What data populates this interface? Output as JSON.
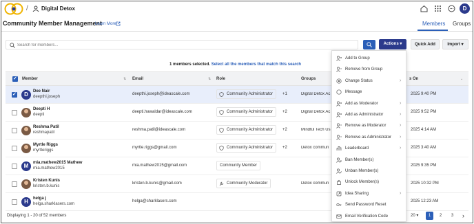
{
  "topnav": {
    "community_name": "Digital Detox",
    "user_initial": "D"
  },
  "header": {
    "title": "Community Member Management",
    "learn_more": "Learn More",
    "tabs": [
      {
        "label": "Members",
        "active": true
      },
      {
        "label": "Groups",
        "active": false
      }
    ]
  },
  "toolbar": {
    "search_placeholder": "Search for members...",
    "actions_label": "Actions ▾",
    "quick_add_label": "Quick Add",
    "import_label": "Import ▾"
  },
  "selection": {
    "count_text": "1 members selected.",
    "link_text": "Select all the members that match this search"
  },
  "table": {
    "columns": {
      "member": "Member",
      "email": "Email",
      "role": "Role",
      "groups": "Groups",
      "joined": "s On"
    },
    "rows": [
      {
        "name": "Dee Nair",
        "username": "deepthi.joseph",
        "email": "deepthi.joseph@ideascale.com",
        "role": "Community Administrator",
        "extra": "+1",
        "groups": "Digital Detox Ac",
        "joined": "2025 9:40 PM",
        "selected": true,
        "avatar_initial": "D",
        "avatar_type": "letter",
        "role_icon": "shield-icon"
      },
      {
        "name": "Deepti H",
        "username": "deepti",
        "email": "deepti.hawaldar@ideascale.com",
        "role": "Community Administrator",
        "extra": "+2",
        "groups": "Digital Detox Ac",
        "joined": "2025 9:52 PM",
        "selected": false,
        "avatar_initial": "",
        "avatar_type": "photo",
        "role_icon": "shield-icon"
      },
      {
        "name": "Reshma Patil",
        "username": "reshmapatil",
        "email": "reshma.patil@ideascale.com",
        "role": "Community Administrator",
        "extra": "+2",
        "groups": "Mindful Tech Us",
        "joined": "2025 4:14 AM",
        "selected": false,
        "avatar_initial": "",
        "avatar_type": "photo",
        "role_icon": "shield-icon"
      },
      {
        "name": "Myrtle Riggs",
        "username": "myrtleriggs",
        "email": "myrtle.riggs@gmail.com",
        "role": "Community Administrator",
        "extra": "+2",
        "groups": "Detox commun",
        "joined": "2025 3:40 AM",
        "selected": false,
        "avatar_initial": "",
        "avatar_type": "photo",
        "role_icon": "shield-icon"
      },
      {
        "name": "mia.mathew2015 Mathew",
        "username": "mia.mathew2015",
        "email": "mia.mathew2015@gmail.com",
        "role": "Community Member",
        "extra": "",
        "groups": "",
        "joined": "2025 9:35 PM",
        "selected": false,
        "avatar_initial": "M",
        "avatar_type": "letter",
        "role_icon": ""
      },
      {
        "name": "Kristen Kunis",
        "username": "kristen.b.kunis",
        "email": "kristen.b.kunis@gmail.com",
        "role": "Community Moderator",
        "extra": "",
        "groups": "Detox commun",
        "joined": "2025 10:32 PM",
        "selected": false,
        "avatar_initial": "",
        "avatar_type": "photo",
        "role_icon": "wrench-icon"
      },
      {
        "name": "helga j",
        "username": "helga.sharklasers.com",
        "email": "helga@sharklasers.com",
        "role": "",
        "extra": "",
        "groups": "",
        "joined": "2025 12:23 AM",
        "selected": false,
        "avatar_initial": "H",
        "avatar_type": "letter",
        "role_icon": ""
      }
    ]
  },
  "actions_menu": [
    {
      "label": "Add to Group",
      "icon": "user-plus-icon",
      "submenu": false
    },
    {
      "label": "Remove from Group",
      "icon": "user-minus-icon",
      "submenu": false
    },
    {
      "label": "Change Status",
      "icon": "status-icon",
      "submenu": true
    },
    {
      "label": "Message",
      "icon": "message-icon",
      "submenu": false
    },
    {
      "label": "Add as Moderator",
      "icon": "user-plus-icon",
      "submenu": true
    },
    {
      "label": "Add as Administrator",
      "icon": "user-plus-icon",
      "submenu": true
    },
    {
      "label": "Remove as Moderator",
      "icon": "user-minus-icon",
      "submenu": true
    },
    {
      "label": "Remove as Administrator",
      "icon": "user-minus-icon",
      "submenu": true
    },
    {
      "label": "Leaderboard",
      "icon": "leaderboard-icon",
      "submenu": true
    },
    {
      "label": "Ban Member(s)",
      "icon": "ban-icon",
      "submenu": false
    },
    {
      "label": "Unban Member(s)",
      "icon": "unban-icon",
      "submenu": false
    },
    {
      "label": "Unlock Member(s)",
      "icon": "unlock-icon",
      "submenu": false
    },
    {
      "label": "Idea Sharing",
      "icon": "share-icon",
      "submenu": true
    },
    {
      "label": "Send Password Reset",
      "icon": "key-icon",
      "submenu": false
    },
    {
      "label": "Email Verification Code",
      "icon": "mail-icon",
      "submenu": false
    }
  ],
  "footer": {
    "display_text": "Displaying 1 - 20 of 52 members",
    "per_page": "20 ▾",
    "pages": [
      "1",
      "2",
      "3"
    ],
    "active_page": "1",
    "next": "›"
  },
  "colors": {
    "primary": "#2b5fb8",
    "primary_dark": "#2b3a8c"
  }
}
